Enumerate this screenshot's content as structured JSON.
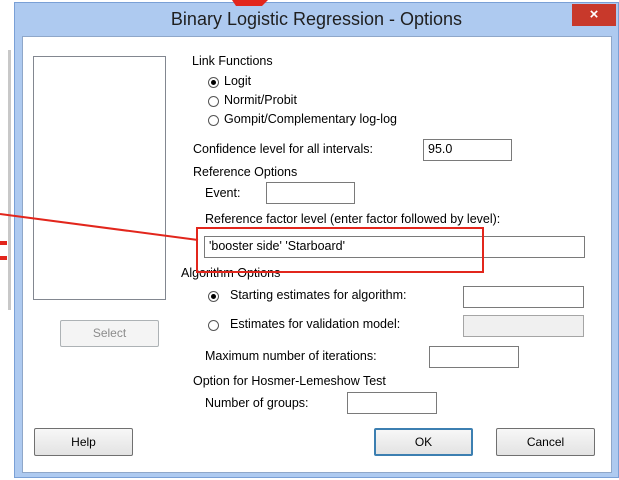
{
  "dialog": {
    "title": "Binary Logistic Regression - Options",
    "close_glyph": "×",
    "variable_list": [],
    "select_label": "Select",
    "link_functions": {
      "label": "Link Functions",
      "options": [
        "Logit",
        "Normit/Probit",
        "Gompit/Complementary log-log"
      ],
      "selected": "Logit"
    },
    "confidence": {
      "label": "Confidence level for all intervals:",
      "value": "95.0"
    },
    "reference": {
      "label": "Reference Options",
      "event_label": "Event:",
      "event_value": "",
      "factor_label": "Reference factor level (enter factor followed by level):",
      "factor_value": "'booster side' 'Starboard'"
    },
    "algorithm": {
      "label": "Algorithm Options",
      "starting_label": "Starting estimates for algorithm:",
      "starting_value": "",
      "validation_label": "Estimates for validation model:",
      "validation_value": "",
      "selected": "Starting estimates for algorithm:",
      "max_iter_label": "Maximum number of iterations:",
      "max_iter_value": ""
    },
    "hosmer": {
      "label": "Option for Hosmer-Lemeshow Test",
      "groups_label": "Number of groups:",
      "groups_value": ""
    },
    "buttons": {
      "help": "Help",
      "ok": "OK",
      "cancel": "Cancel"
    }
  },
  "colors": {
    "title_bar": "#aecaf0",
    "close_button": "#c8392b",
    "annotation_red": "#e2261c"
  },
  "icons": {
    "close": "close-icon",
    "radio_checked": "radio-checked-icon",
    "radio_unchecked": "radio-unchecked-icon"
  }
}
